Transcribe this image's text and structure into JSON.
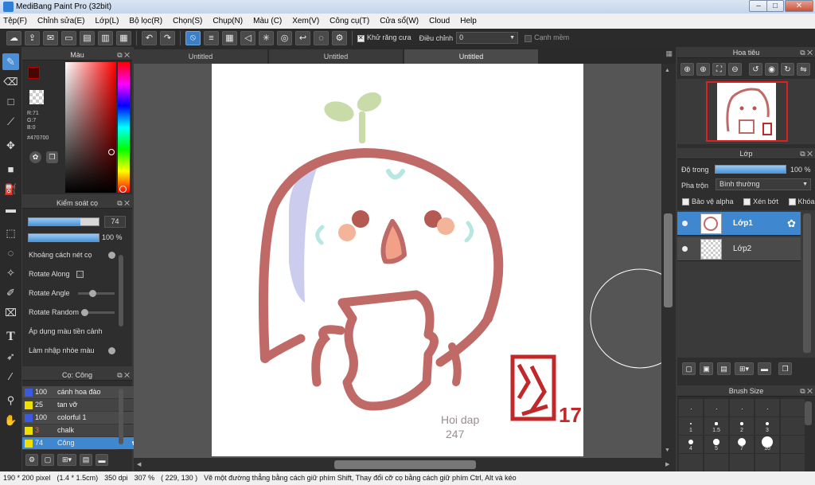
{
  "window": {
    "title": "MediBang Paint Pro (32bit)",
    "min": "–",
    "max": "□",
    "close": "✕"
  },
  "menu": [
    "Tệp(F)",
    "Chỉnh sửa(E)",
    "Lớp(L)",
    "Bộ lọc(R)",
    "Chọn(S)",
    "Chụp(N)",
    "Màu (C)",
    "Xem(V)",
    "Công cụ(T)",
    "Cửa sổ(W)",
    "Cloud",
    "Help"
  ],
  "toolbar": {
    "antialias_label": "Khử răng cưa",
    "correction_label": "Điều chỉnh",
    "correction_value": "0",
    "sharp_edge_label": "Cạnh mềm",
    "antialias_checked": true,
    "sharp_edge_checked": false
  },
  "color_panel": {
    "title": "Màu",
    "r": "R:71",
    "g": "G:7",
    "b": "B:0",
    "hex": "#470700",
    "fg_color": "#470700",
    "bg_color": "#ffffff"
  },
  "brush_control": {
    "title": "Kiểm soát cọ",
    "size_value": "74",
    "opacity_value": "100 %",
    "size_fraction": 0.74,
    "opacity_fraction": 1.0,
    "options": [
      "Khoảng cách nét cọ",
      "Rotate Along",
      "Rotate Angle",
      "Rotate Random",
      "Áp dụng màu tiền cảnh",
      "Làm nhập nhòe màu"
    ]
  },
  "brush_list": {
    "title": "Cọ: Công",
    "items": [
      {
        "size": "100",
        "name": "cánh hoa đào",
        "color": "#3a5ae0",
        "selected": false
      },
      {
        "size": "25",
        "name": "tan vỡ",
        "color": "#f0e000",
        "selected": false
      },
      {
        "size": "100",
        "name": "colorful 1",
        "color": "#3a5ae0",
        "selected": false
      },
      {
        "size": "3",
        "name": "chalk",
        "color": "#f0e000",
        "selected": false,
        "size_color": "#ff6a3a"
      },
      {
        "size": "74",
        "name": "Công",
        "color": "#f0e000",
        "selected": true
      }
    ]
  },
  "tabs": [
    "Untitled",
    "Untitled",
    "Untitled"
  ],
  "active_tab": 2,
  "canvas": {
    "signature": "Hoi dap 247",
    "stamp_number": "17"
  },
  "navigator": {
    "title": "Hoa tiêu"
  },
  "layers": {
    "title": "Lớp",
    "opacity_label": "Độ trong",
    "opacity_value": "100 %",
    "opacity_fraction": 1.0,
    "blend_label": "Pha trộn",
    "blend_value": "Bình thường",
    "protect_alpha": "Bảo vệ alpha",
    "clipping": "Xén bớt",
    "lock": "Khóa",
    "items": [
      {
        "name": "Lớp1",
        "selected": true
      },
      {
        "name": "Lớp2",
        "selected": false
      }
    ]
  },
  "brush_size": {
    "title": "Brush Size",
    "labels": [
      "1",
      "1.5",
      "2",
      "3",
      "4",
      "5",
      "7",
      "10"
    ]
  },
  "status": {
    "size": "190 * 200 pixel",
    "cm": "(1.4 * 1.5cm)",
    "dpi": "350 dpi",
    "zoom": "307 %",
    "coords": "( 229, 130 )",
    "hint": "Vẽ một đường thẳng bằng cách giữ phím Shift, Thay đổi cỡ cọ bằng cách giữ phím Ctrl, Alt và kéo"
  }
}
